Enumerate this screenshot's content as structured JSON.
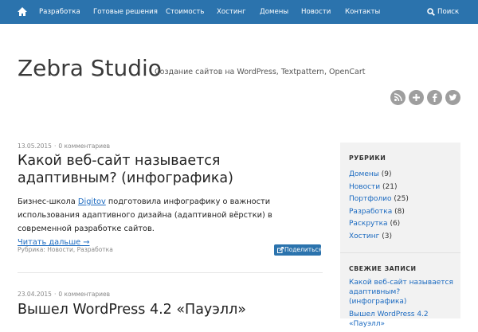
{
  "nav": {
    "items": [
      "Разработка",
      "Готовые решения",
      "Стоимость",
      "Хостинг",
      "Домены",
      "Новости",
      "Контакты"
    ],
    "search_label": "Поиск",
    "bg_color": "#2b73ad"
  },
  "site": {
    "title": "Zebra Studio",
    "description": "Создание сайтов на WordPress, Textpattern, OpenCart"
  },
  "posts": [
    {
      "date": "13.05.2015",
      "comments": "0 комментариев",
      "title": "Какой веб-сайт называется адаптивным? (инфографика)",
      "excerpt_before": "Бизнес-школа ",
      "excerpt_link": "Digitov",
      "excerpt_after": " подготовила инфографику о важности использования адаптивного дизайна (адаптивной вёрстки) в современной разработке сайтов.",
      "read_more": "Читать дальше →",
      "categories": "Рубрика: Новости, Разработка",
      "share_label": "Поделиться"
    },
    {
      "date": "23.04.2015",
      "comments": "0 комментариев",
      "title": "Вышел WordPress 4.2 «Пауэлл»"
    }
  ],
  "sidebar": {
    "categories_title": "РУБРИКИ",
    "categories": [
      {
        "name": "Домены",
        "count": "(9)"
      },
      {
        "name": "Новости",
        "count": "(21)"
      },
      {
        "name": "Портфолио",
        "count": "(25)"
      },
      {
        "name": "Разработка",
        "count": "(8)"
      },
      {
        "name": "Раскрутка",
        "count": "(6)"
      },
      {
        "name": "Хостинг",
        "count": "(3)"
      }
    ],
    "recent_title": "СВЕЖИЕ ЗАПИСИ",
    "recent": [
      "Какой веб-сайт называется адаптивным? (инфографика)",
      "Вышел WordPress 4.2 «Пауэлл»"
    ]
  },
  "social_icons": [
    "rss-icon",
    "google-plus-icon",
    "facebook-icon",
    "twitter-icon"
  ],
  "colors": {
    "link": "#1b6ac0",
    "accent": "#2b73ad",
    "social": "#9e9e9e"
  }
}
